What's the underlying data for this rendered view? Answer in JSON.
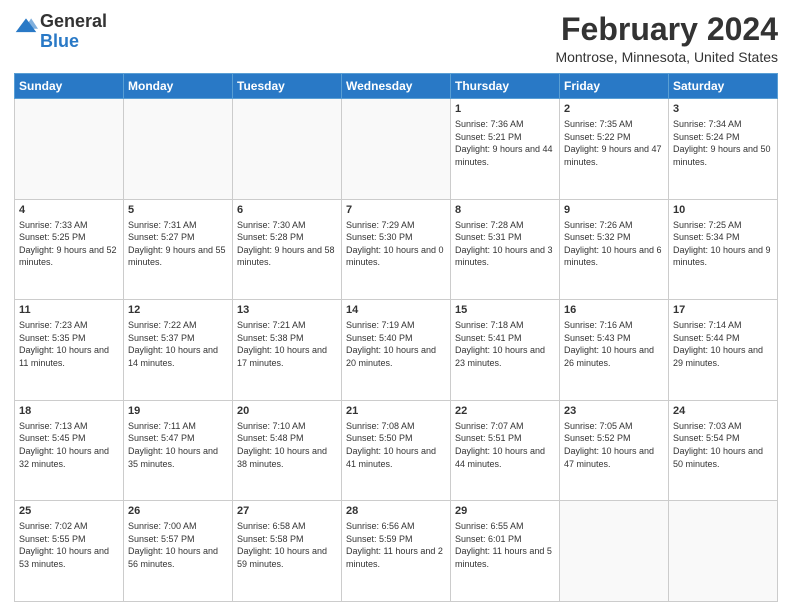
{
  "header": {
    "logo_general": "General",
    "logo_blue": "Blue",
    "month_year": "February 2024",
    "location": "Montrose, Minnesota, United States"
  },
  "days_of_week": [
    "Sunday",
    "Monday",
    "Tuesday",
    "Wednesday",
    "Thursday",
    "Friday",
    "Saturday"
  ],
  "weeks": [
    [
      {
        "day": "",
        "info": ""
      },
      {
        "day": "",
        "info": ""
      },
      {
        "day": "",
        "info": ""
      },
      {
        "day": "",
        "info": ""
      },
      {
        "day": "1",
        "info": "Sunrise: 7:36 AM\nSunset: 5:21 PM\nDaylight: 9 hours\nand 44 minutes."
      },
      {
        "day": "2",
        "info": "Sunrise: 7:35 AM\nSunset: 5:22 PM\nDaylight: 9 hours\nand 47 minutes."
      },
      {
        "day": "3",
        "info": "Sunrise: 7:34 AM\nSunset: 5:24 PM\nDaylight: 9 hours\nand 50 minutes."
      }
    ],
    [
      {
        "day": "4",
        "info": "Sunrise: 7:33 AM\nSunset: 5:25 PM\nDaylight: 9 hours\nand 52 minutes."
      },
      {
        "day": "5",
        "info": "Sunrise: 7:31 AM\nSunset: 5:27 PM\nDaylight: 9 hours\nand 55 minutes."
      },
      {
        "day": "6",
        "info": "Sunrise: 7:30 AM\nSunset: 5:28 PM\nDaylight: 9 hours\nand 58 minutes."
      },
      {
        "day": "7",
        "info": "Sunrise: 7:29 AM\nSunset: 5:30 PM\nDaylight: 10 hours\nand 0 minutes."
      },
      {
        "day": "8",
        "info": "Sunrise: 7:28 AM\nSunset: 5:31 PM\nDaylight: 10 hours\nand 3 minutes."
      },
      {
        "day": "9",
        "info": "Sunrise: 7:26 AM\nSunset: 5:32 PM\nDaylight: 10 hours\nand 6 minutes."
      },
      {
        "day": "10",
        "info": "Sunrise: 7:25 AM\nSunset: 5:34 PM\nDaylight: 10 hours\nand 9 minutes."
      }
    ],
    [
      {
        "day": "11",
        "info": "Sunrise: 7:23 AM\nSunset: 5:35 PM\nDaylight: 10 hours\nand 11 minutes."
      },
      {
        "day": "12",
        "info": "Sunrise: 7:22 AM\nSunset: 5:37 PM\nDaylight: 10 hours\nand 14 minutes."
      },
      {
        "day": "13",
        "info": "Sunrise: 7:21 AM\nSunset: 5:38 PM\nDaylight: 10 hours\nand 17 minutes."
      },
      {
        "day": "14",
        "info": "Sunrise: 7:19 AM\nSunset: 5:40 PM\nDaylight: 10 hours\nand 20 minutes."
      },
      {
        "day": "15",
        "info": "Sunrise: 7:18 AM\nSunset: 5:41 PM\nDaylight: 10 hours\nand 23 minutes."
      },
      {
        "day": "16",
        "info": "Sunrise: 7:16 AM\nSunset: 5:43 PM\nDaylight: 10 hours\nand 26 minutes."
      },
      {
        "day": "17",
        "info": "Sunrise: 7:14 AM\nSunset: 5:44 PM\nDaylight: 10 hours\nand 29 minutes."
      }
    ],
    [
      {
        "day": "18",
        "info": "Sunrise: 7:13 AM\nSunset: 5:45 PM\nDaylight: 10 hours\nand 32 minutes."
      },
      {
        "day": "19",
        "info": "Sunrise: 7:11 AM\nSunset: 5:47 PM\nDaylight: 10 hours\nand 35 minutes."
      },
      {
        "day": "20",
        "info": "Sunrise: 7:10 AM\nSunset: 5:48 PM\nDaylight: 10 hours\nand 38 minutes."
      },
      {
        "day": "21",
        "info": "Sunrise: 7:08 AM\nSunset: 5:50 PM\nDaylight: 10 hours\nand 41 minutes."
      },
      {
        "day": "22",
        "info": "Sunrise: 7:07 AM\nSunset: 5:51 PM\nDaylight: 10 hours\nand 44 minutes."
      },
      {
        "day": "23",
        "info": "Sunrise: 7:05 AM\nSunset: 5:52 PM\nDaylight: 10 hours\nand 47 minutes."
      },
      {
        "day": "24",
        "info": "Sunrise: 7:03 AM\nSunset: 5:54 PM\nDaylight: 10 hours\nand 50 minutes."
      }
    ],
    [
      {
        "day": "25",
        "info": "Sunrise: 7:02 AM\nSunset: 5:55 PM\nDaylight: 10 hours\nand 53 minutes."
      },
      {
        "day": "26",
        "info": "Sunrise: 7:00 AM\nSunset: 5:57 PM\nDaylight: 10 hours\nand 56 minutes."
      },
      {
        "day": "27",
        "info": "Sunrise: 6:58 AM\nSunset: 5:58 PM\nDaylight: 10 hours\nand 59 minutes."
      },
      {
        "day": "28",
        "info": "Sunrise: 6:56 AM\nSunset: 5:59 PM\nDaylight: 11 hours\nand 2 minutes."
      },
      {
        "day": "29",
        "info": "Sunrise: 6:55 AM\nSunset: 6:01 PM\nDaylight: 11 hours\nand 5 minutes."
      },
      {
        "day": "",
        "info": ""
      },
      {
        "day": "",
        "info": ""
      }
    ]
  ]
}
